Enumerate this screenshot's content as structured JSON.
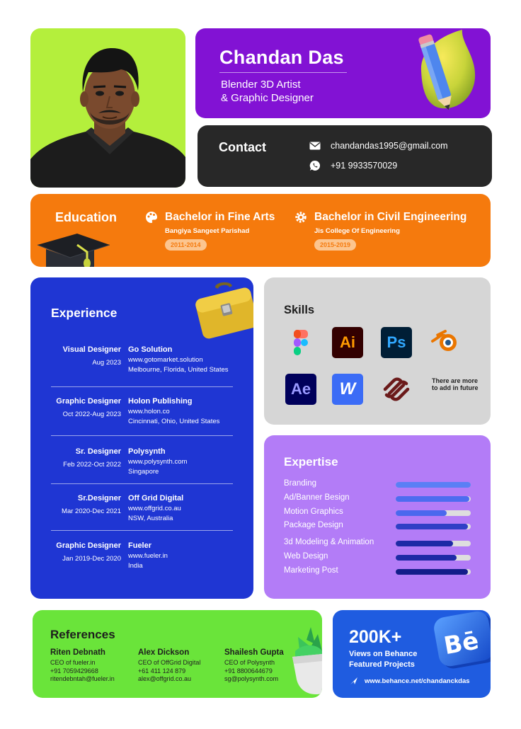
{
  "header": {
    "name": "Chandan Das",
    "role_line1": "Blender 3D Artist",
    "role_line2": "& Graphic Designer"
  },
  "contact": {
    "title": "Contact",
    "email": "chandandas1995@gmail.com",
    "phone": "+91 9933570029",
    "email_icon": "mail-icon",
    "phone_icon": "whatsapp-icon"
  },
  "education": {
    "title": "Education",
    "items": [
      {
        "degree": "Bachelor in Fine Arts",
        "school": "Bangiya Sangeet Parishad",
        "years": "2011-2014",
        "icon": "palette-icon"
      },
      {
        "degree": "Bachelor in Civil Engineering",
        "school": "Jis College Of Engineering",
        "years": "2015-2019",
        "icon": "gear-icon"
      }
    ]
  },
  "experience": {
    "title": "Experience",
    "jobs": [
      {
        "position": "Visual Designer",
        "dates": "Aug 2023",
        "company": "Go Solution",
        "url": "www.gotomarket.solution",
        "location": "Melbourne, Florida, United States"
      },
      {
        "position": "Graphic Designer",
        "dates": "Oct 2022-Aug 2023",
        "company": "Holon Publishing",
        "url": "www.holon.co",
        "location": "Cincinnati, Ohio, United States"
      },
      {
        "position": "Sr. Designer",
        "dates": "Feb 2022-Oct 2022",
        "company": "Polysynth",
        "url": "www.polysynth.com",
        "location": "Singapore"
      },
      {
        "position": "Sr.Designer",
        "dates": "Mar 2020-Dec 2021",
        "company": "Off Grid Digital",
        "url": "www.offgrid.co.au",
        "location": "NSW, Australia"
      },
      {
        "position": "Graphic Designer",
        "dates": "Jan 2019-Dec 2020",
        "company": "Fueler",
        "url": "www.fueler.in",
        "location": "India"
      }
    ]
  },
  "skills": {
    "title": "Skills",
    "tools": [
      {
        "name": "figma-icon"
      },
      {
        "name": "illustrator-icon",
        "label": "Ai"
      },
      {
        "name": "photoshop-icon",
        "label": "Ps"
      },
      {
        "name": "blender-icon"
      },
      {
        "name": "after-effects-icon",
        "label": "Ae"
      },
      {
        "name": "webflow-icon",
        "label": "W"
      },
      {
        "name": "squarespace-icon"
      }
    ],
    "more_note": "There are more to add in future"
  },
  "expertise": {
    "title": "Expertise",
    "items": [
      {
        "label": "Branding",
        "level": 1.0,
        "color": "#5b7ff5"
      },
      {
        "label": "Ad/Banner Besign",
        "level": 0.98,
        "color": "#4d6cf0"
      },
      {
        "label": "Motion Graphics",
        "level": 0.68,
        "color": "#4a68ee"
      },
      {
        "label": "Package Design",
        "level": 0.96,
        "color": "#2f3fc6"
      },
      {
        "label": "3d Modeling & Animation",
        "level": 0.76,
        "color": "#1e2aa6"
      },
      {
        "label": "Web Design",
        "level": 0.81,
        "color": "#1e2aa6"
      },
      {
        "label": "Marketing Post",
        "level": 0.96,
        "color": "#141d8a"
      }
    ]
  },
  "references": {
    "title": "References",
    "people": [
      {
        "name": "Riten Debnath",
        "role": "CEO of fueler.in",
        "phone": "+91 7059429668",
        "email": "ritendebntah@fueler.in"
      },
      {
        "name": "Alex Dickson",
        "role": "CEO of OffGrid Digital",
        "phone": "+61 411 124 879",
        "email": "alex@offgrid.co.au"
      },
      {
        "name": "Shailesh Gupta",
        "role": "CEO of Polysynth",
        "phone": "+91 8800644679",
        "email": "sg@polysynth.com"
      }
    ]
  },
  "behance": {
    "count": "200K+",
    "line1": "Views on Behance",
    "line2": "Featured Projects",
    "url": "www.behance.net/chandanckdas",
    "logo_text": "Bē"
  }
}
